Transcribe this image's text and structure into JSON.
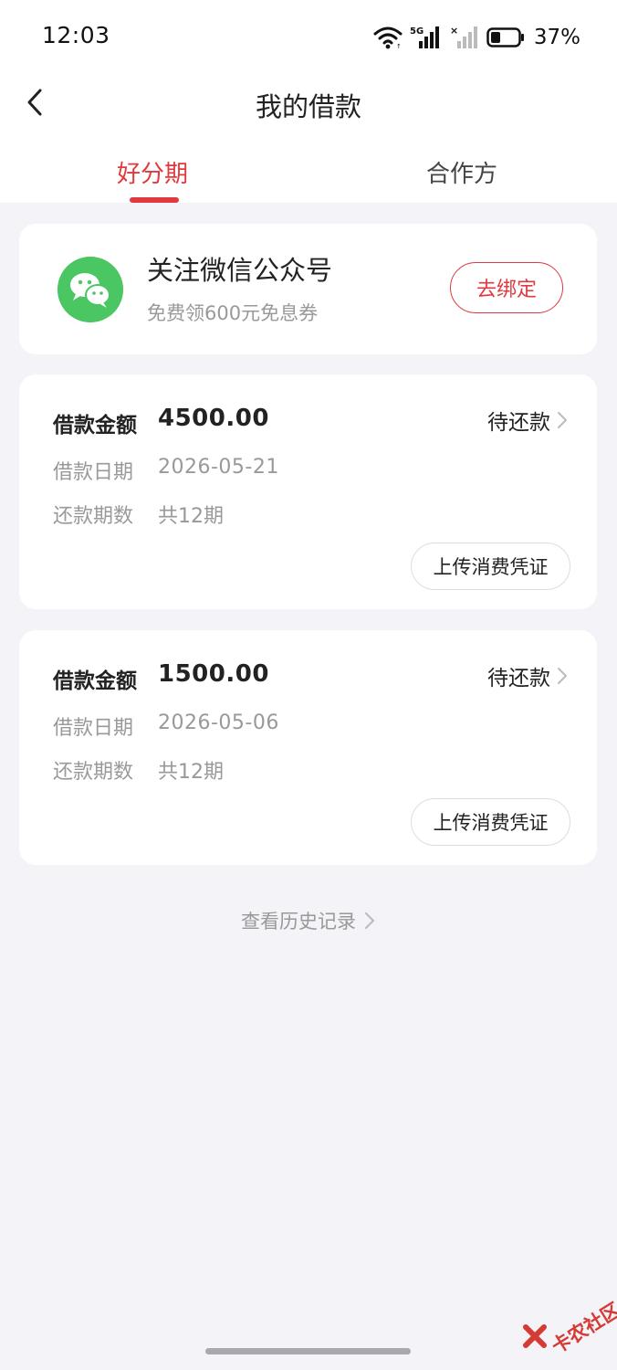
{
  "status_bar": {
    "time": "12:03",
    "battery_percent": "37%",
    "battery_level": 0.37
  },
  "nav": {
    "title": "我的借款"
  },
  "tabs": [
    {
      "label": "好分期",
      "active": true
    },
    {
      "label": "合作方",
      "active": false
    }
  ],
  "promo": {
    "title": "关注微信公众号",
    "subtitle": "免费领600元免息券",
    "button": "去绑定",
    "icon": "wechat-icon"
  },
  "loans": [
    {
      "amount_label": "借款金额",
      "amount": "4500.00",
      "status": "待还款",
      "date_label": "借款日期",
      "date": "2026-05-21",
      "periods_label": "还款期数",
      "periods": "共12期",
      "upload_button": "上传消费凭证"
    },
    {
      "amount_label": "借款金额",
      "amount": "1500.00",
      "status": "待还款",
      "date_label": "借款日期",
      "date": "2026-05-06",
      "periods_label": "还款期数",
      "periods": "共12期",
      "upload_button": "上传消费凭证"
    }
  ],
  "history_link": "查看历史记录",
  "watermark": "卡农社区",
  "colors": {
    "accent": "#e0393e",
    "wechat_green": "#4ac662",
    "background": "#f3f3f8"
  }
}
